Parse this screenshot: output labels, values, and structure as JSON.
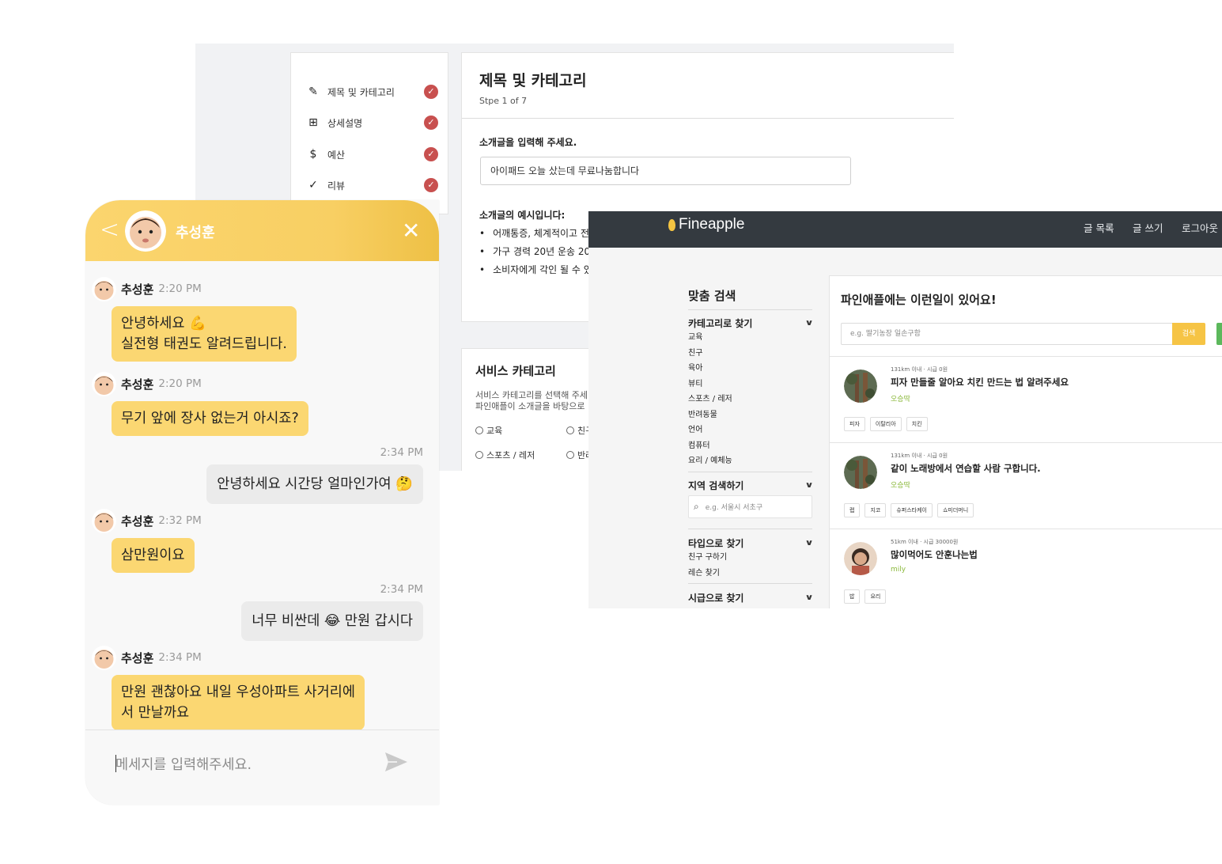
{
  "wizard": {
    "steps": [
      {
        "label": "제목 및 카테고리",
        "icon": "pencil-icon",
        "glyph": "✎"
      },
      {
        "label": "상세설명",
        "icon": "note-add-icon",
        "glyph": "⊞"
      },
      {
        "label": "예산",
        "icon": "dollar-icon",
        "glyph": "$"
      },
      {
        "label": "리뷰",
        "icon": "checkmark-icon",
        "glyph": "✓"
      }
    ],
    "title": "제목 및 카테고리",
    "step_text": "Stpe 1 of 7",
    "intro_label": "소개글을 입력해 주세요.",
    "intro_value": "아이패드 오늘 샀는데 무료나눔합니다",
    "example_label": "소개글의 예시입니다:",
    "examples": [
      "어깨통증, 체계적이고 전",
      "가구 경력 20년 운송 20",
      "소비자에게 각인 될 수 있"
    ],
    "service": {
      "title": "서비스 카테고리",
      "desc1": "서비스 카테고리를 선택해 주세",
      "desc2": "파인애플이 소개글을 바탕으로",
      "options": [
        "교육",
        "친구",
        "스포츠 / 레저",
        "반려"
      ]
    }
  },
  "fineapple": {
    "brand": "Fineapple",
    "nav": [
      "글 목록",
      "글 쓰기",
      "로그아웃"
    ],
    "filter_title": "맞춤 검색",
    "category_head": "카테고리로 찾기",
    "categories": [
      "교육",
      "친구",
      "육아",
      "뷰티",
      "스포츠 / 레저",
      "반려동물",
      "언어",
      "컴퓨터",
      "요리 / 예체능"
    ],
    "region_head": "지역 검색하기",
    "region_placeholder": "e.g. 서울시 서초구",
    "type_head": "타입으로 찾기",
    "types": [
      "친구 구하기",
      "레슨 찾기"
    ],
    "pay_head": "시급으로 찾기",
    "feed_title": "파인애플에는 이런일이 있어요!",
    "search_placeholder": "e.g. 딸기농장 일손구함",
    "search_button": "검색",
    "posts": [
      {
        "meta": "131km 이내 · 시급 0원",
        "title": "피자 만들줄 알아요 치킨 만드는 법 알려주세요",
        "author": "오승딱",
        "tags": [
          "피자",
          "이탈리아",
          "치킨"
        ]
      },
      {
        "meta": "131km 이내 · 시급 0원",
        "title": "같이 노래방에서 연습할 사람 구합니다.",
        "author": "오승딱",
        "tags": [
          "랩",
          "지코",
          "슈퍼스타케이",
          "쇼미더머니"
        ]
      },
      {
        "meta": "51km 이내 · 시급 30000원",
        "title": "많이먹어도 안훈나는법",
        "author": "mily",
        "tags": [
          "밥",
          "요리"
        ]
      }
    ]
  },
  "chat": {
    "partner_name": "추성훈",
    "messages": [
      {
        "type": "in",
        "name": "추성훈",
        "time": "2:20 PM",
        "text": [
          "안녕하세요 💪",
          "실전형 태권도 알려드립니다."
        ]
      },
      {
        "type": "in",
        "name": "추성훈",
        "time": "2:20 PM",
        "text": [
          "무기 앞에 장사 없는거 아시죠?"
        ]
      },
      {
        "type": "out",
        "time": "2:34 PM",
        "text": "안녕하세요 시간당 얼마인가여 🤔"
      },
      {
        "type": "in",
        "name": "추성훈",
        "time": "2:32 PM",
        "text": [
          "삼만원이요"
        ]
      },
      {
        "type": "out",
        "time": "2:34 PM",
        "text": "너무 비싼데 😂 만원 갑시다"
      },
      {
        "type": "in",
        "name": "추성훈",
        "time": "2:34 PM",
        "text": [
          "만원 괜찮아요 내일 우성아파트 사거리에",
          "서 만날까요"
        ]
      }
    ],
    "input_placeholder": "메세지를 입력해주세요.",
    "colors": {
      "accent": "#fbd772",
      "header": "#f8cf63",
      "outgoing": "#ebebeb",
      "check": "#c8504f",
      "nav": "#343a40",
      "tag_author": "#8bb93c"
    }
  }
}
